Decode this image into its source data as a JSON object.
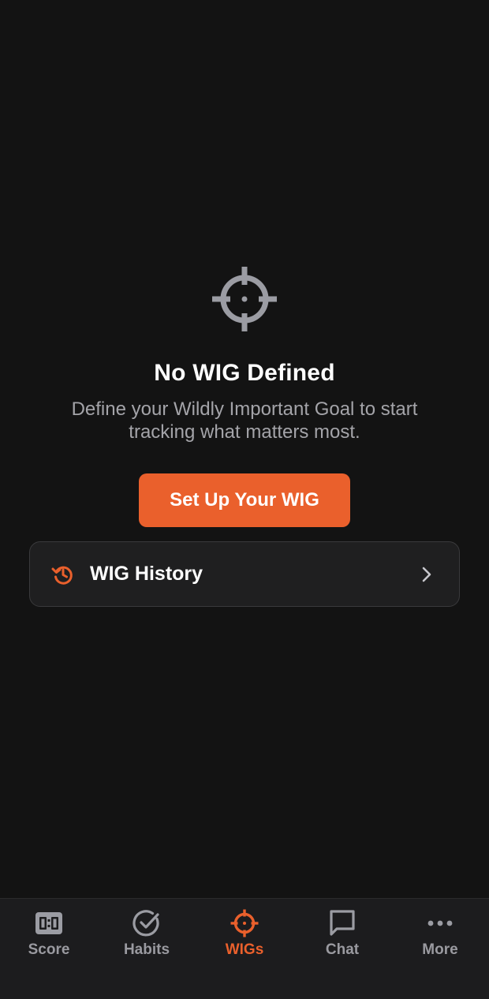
{
  "colors": {
    "background": "#131313",
    "accent": "#ea602c",
    "icon_gray": "#9b9ca3",
    "muted_text": "#a4a4a9",
    "card_bg": "#1f1f20",
    "tab_bar_bg": "#1c1c1e"
  },
  "empty_state": {
    "icon": "crosshair-target-icon",
    "title": "No WIG Defined",
    "description": "Define your Wildly Important Goal to start tracking what matters most.",
    "setup_button_label": "Set Up Your WIG"
  },
  "history_row": {
    "icon": "history-icon",
    "label": "WIG History",
    "trailing_icon": "chevron-right-icon"
  },
  "tab_bar": {
    "active": "WIGs",
    "tabs": [
      {
        "label": "Score",
        "icon": "scoreboard-icon"
      },
      {
        "label": "Habits",
        "icon": "check-circle-icon"
      },
      {
        "label": "WIGs",
        "icon": "crosshair-target-icon"
      },
      {
        "label": "Chat",
        "icon": "chat-bubble-icon"
      },
      {
        "label": "More",
        "icon": "more-dots-icon"
      }
    ]
  }
}
